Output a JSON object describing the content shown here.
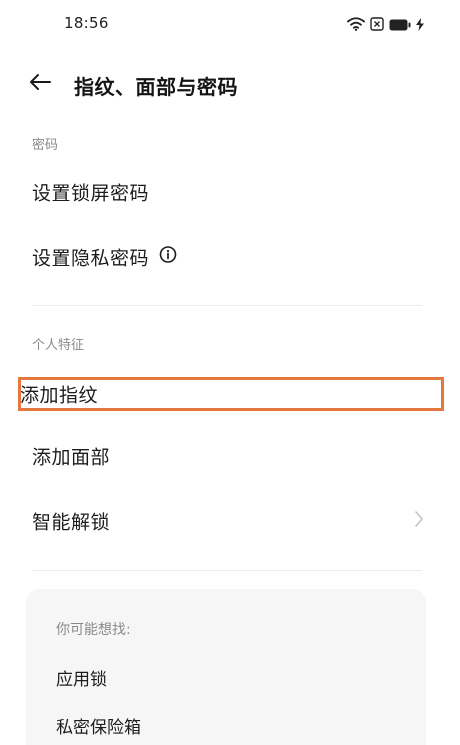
{
  "status_bar": {
    "time": "18:56",
    "icons": [
      "wifi-icon",
      "sim-icon",
      "battery-icon",
      "charging-icon"
    ]
  },
  "app_bar": {
    "title": "指纹、面部与密码",
    "back_icon": "arrow-left-icon"
  },
  "sections": {
    "password": {
      "header": "密码",
      "items": [
        {
          "label": "设置锁屏密码"
        },
        {
          "label": "设置隐私密码",
          "icon": "info-icon"
        }
      ]
    },
    "biometrics": {
      "header": "个人特征",
      "items": [
        {
          "label": "添加指纹",
          "highlighted": true
        },
        {
          "label": "添加面部"
        },
        {
          "label": "智能解锁",
          "icon": "chevron-right-icon"
        }
      ]
    }
  },
  "suggestions": {
    "title": "你可能想找:",
    "items": [
      {
        "label": "应用锁"
      },
      {
        "label": "私密保险箱"
      }
    ]
  },
  "colors": {
    "highlight": "#e4783e",
    "card_bg": "#f6f6f6",
    "secondary_text": "#8a8a8a"
  }
}
